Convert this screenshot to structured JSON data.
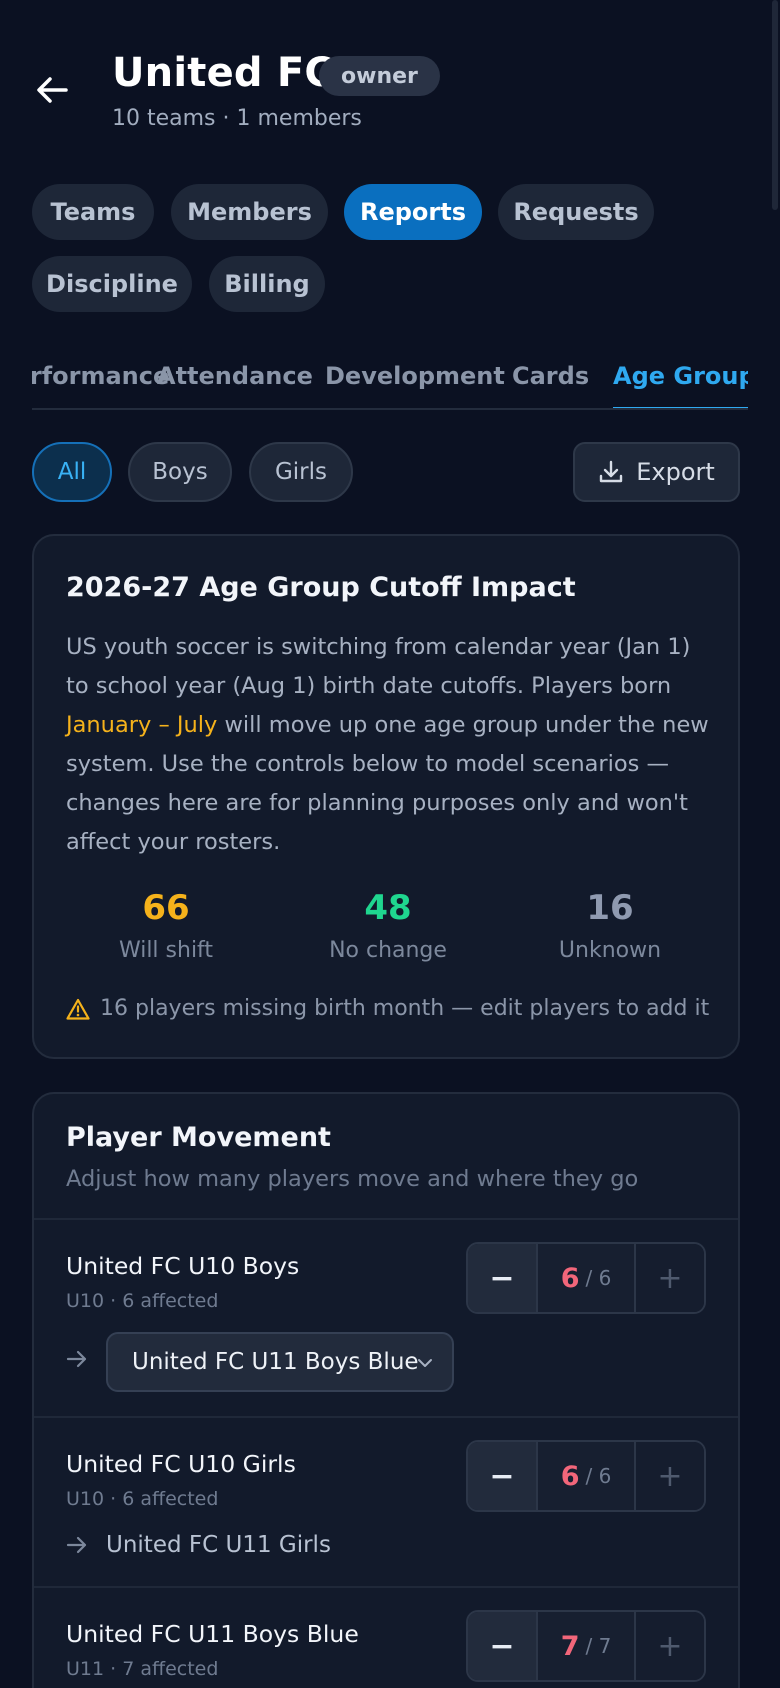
{
  "header": {
    "title": "United FC",
    "role_badge": "owner",
    "subtitle": "10 teams · 1 members",
    "back_icon": "arrow-left-icon"
  },
  "nav": {
    "tabs": [
      {
        "label": "Teams",
        "active": false
      },
      {
        "label": "Members",
        "active": false
      },
      {
        "label": "Reports",
        "active": true
      },
      {
        "label": "Requests",
        "active": false
      },
      {
        "label": "Discipline",
        "active": false
      },
      {
        "label": "Billing",
        "active": false
      }
    ]
  },
  "report_tabs": [
    {
      "label": "Performance",
      "active": false
    },
    {
      "label": "Attendance",
      "active": false
    },
    {
      "label": "Development",
      "active": false
    },
    {
      "label": "Cards",
      "active": false
    },
    {
      "label": "Age Groups",
      "active": true
    }
  ],
  "filters": {
    "chips": [
      {
        "label": "All",
        "active": true
      },
      {
        "label": "Boys",
        "active": false
      },
      {
        "label": "Girls",
        "active": false
      }
    ],
    "export_label": "Export",
    "export_icon": "download-icon"
  },
  "impact": {
    "title": "2026-27 Age Group Cutoff Impact",
    "text_before": "US youth soccer is switching from calendar year (Jan 1) to school year (Aug 1) birth date cutoffs. Players born ",
    "text_highlight": "January – July",
    "text_after": " will move up one age group under the new system. Use the controls below to model scenarios — changes here are for planning purposes only and won't affect your rosters.",
    "stats": [
      {
        "value": "66",
        "label": "Will shift",
        "color": "#f5b21b"
      },
      {
        "value": "48",
        "label": "No change",
        "color": "#1fd68f"
      },
      {
        "value": "16",
        "label": "Unknown",
        "color": "#8f9ab0"
      }
    ],
    "warning": "16 players missing birth month — edit players to add it",
    "warning_color": "#f5b21b"
  },
  "movement": {
    "title": "Player Movement",
    "subtitle": "Adjust how many players move and where they go",
    "teams": [
      {
        "name": "United FC U10 Boys",
        "meta": "U10 · 6 affected",
        "count": "6",
        "total": "/ 6",
        "destination": "United FC U11 Boys Blue",
        "destination_is_select": true
      },
      {
        "name": "United FC U10 Girls",
        "meta": "U10 · 6 affected",
        "count": "6",
        "total": "/ 6",
        "destination": "United FC U11 Girls",
        "destination_is_select": false
      },
      {
        "name": "United FC U11 Boys Blue",
        "meta": "U11 · 7 affected",
        "count": "7",
        "total": "/ 7"
      }
    ],
    "minus_label": "−",
    "plus_label": "+"
  }
}
